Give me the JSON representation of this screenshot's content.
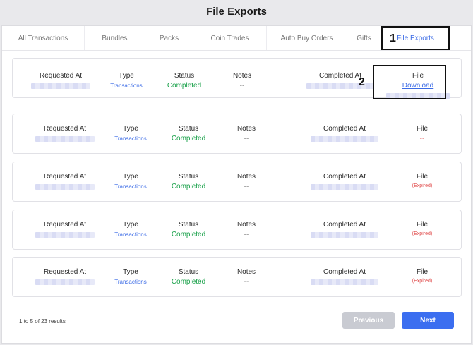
{
  "title": "File Exports",
  "tabs": [
    {
      "label": "All Transactions",
      "w": 117
    },
    {
      "label": "Bundles",
      "w": 86
    },
    {
      "label": "Packs",
      "w": 68
    },
    {
      "label": "Coin Trades",
      "w": 104
    },
    {
      "label": "Auto Buy Orders",
      "w": 114
    },
    {
      "label": "Gifts",
      "w": 48
    },
    {
      "label": "File Exports",
      "w": 97,
      "active": true
    }
  ],
  "markers": {
    "one": "1",
    "two": "2"
  },
  "headers": {
    "requested_at": "Requested At",
    "type": "Type",
    "status": "Status",
    "notes": "Notes",
    "completed_at": "Completed At",
    "file": "File"
  },
  "rows": [
    {
      "type": "Transactions",
      "status": "Completed",
      "notes": "--",
      "file": "Download",
      "file_kind": "link"
    },
    {
      "type": "Transactions",
      "status": "Completed",
      "notes": "--",
      "file": "--",
      "file_kind": "red"
    },
    {
      "type": "Transactions",
      "status": "Completed",
      "notes": "--",
      "file": "(Expired)",
      "file_kind": "expired"
    },
    {
      "type": "Transactions",
      "status": "Completed",
      "notes": "--",
      "file": "(Expired)",
      "file_kind": "expired"
    },
    {
      "type": "Transactions",
      "status": "Completed",
      "notes": "--",
      "file": "(Expired)",
      "file_kind": "expired"
    }
  ],
  "pagination": {
    "summary": "1 to 5 of 23 results",
    "previous": "Previous",
    "next": "Next"
  }
}
